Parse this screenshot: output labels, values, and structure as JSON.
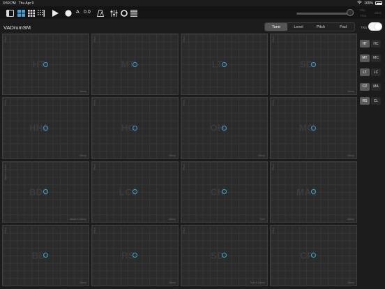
{
  "status": {
    "time": "3:59 PM",
    "date": "Thu Apr 9",
    "battery": "100%"
  },
  "toolbar": {
    "automation_label": "A",
    "value": "0.0",
    "faint_1": "Clip",
    "faint_2": "Tmp",
    "faint_3": "Click"
  },
  "header": {
    "title": "VADrumSM",
    "trg_label": "TRG",
    "trg_on": true
  },
  "tabs": [
    {
      "label": "Tone",
      "active": true
    },
    {
      "label": "Level",
      "active": false
    },
    {
      "label": "Pitch",
      "active": false
    },
    {
      "label": "Pad",
      "active": false
    }
  ],
  "pads": [
    {
      "ghost": "HT",
      "ylabel": "Pitch",
      "xlabel": "Decay"
    },
    {
      "ghost": "MT",
      "ylabel": "Pitch",
      "xlabel": ""
    },
    {
      "ghost": "LT",
      "ylabel": "Pitch",
      "xlabel": ""
    },
    {
      "ghost": "SD",
      "ylabel": "Pitch",
      "xlabel": "Decay"
    },
    {
      "ghost": "HH2",
      "ylabel": "Pitch",
      "xlabel": "Decay"
    },
    {
      "ghost": "HC",
      "ylabel": "Pitch",
      "xlabel": "Decay"
    },
    {
      "ghost": "OH",
      "ylabel": "Pitch",
      "xlabel": "Decay"
    },
    {
      "ghost": "MC",
      "ylabel": "Pitch",
      "xlabel": "Decay"
    },
    {
      "ghost": "BD2",
      "ylabel": "Attack & Noise",
      "xlabel": "Attack & Decay"
    },
    {
      "ghost": "LC2",
      "ylabel": "Pitch",
      "xlabel": "Decay"
    },
    {
      "ghost": "CH",
      "ylabel": "Pitch",
      "xlabel": "Tone"
    },
    {
      "ghost": "MA2",
      "ylabel": "Pitch",
      "xlabel": "Decay"
    },
    {
      "ghost": "BD",
      "ylabel": "Pitch",
      "xlabel": "Decay"
    },
    {
      "ghost": "RS",
      "ylabel": "Pitch",
      "xlabel": "Decay"
    },
    {
      "ghost": "SD",
      "ylabel": "Pitch",
      "xlabel": "Tone & Decay"
    },
    {
      "ghost": "CP",
      "ylabel": "Pitch",
      "xlabel": "Decay"
    }
  ],
  "right_buttons": [
    [
      {
        "label": "HT",
        "on": true
      },
      {
        "label": "HC",
        "on": false
      }
    ],
    [
      {
        "label": "MT",
        "on": true
      },
      {
        "label": "MC",
        "on": false
      }
    ],
    [
      {
        "label": "LT",
        "on": true
      },
      {
        "label": "LC",
        "on": false
      }
    ],
    [
      {
        "label": "CP",
        "on": true
      },
      {
        "label": "MA",
        "on": false
      }
    ],
    [
      {
        "label": "RS",
        "on": true
      },
      {
        "label": "CL",
        "on": false
      }
    ]
  ],
  "colors": {
    "accent": "#3aa7d6",
    "background": "#1c1c1c",
    "pad": "#2b2b2b"
  }
}
